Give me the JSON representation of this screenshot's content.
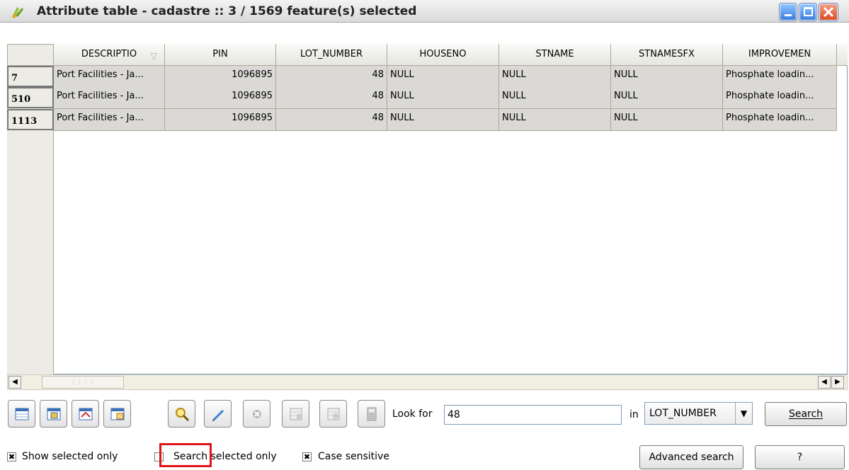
{
  "window": {
    "title": "Attribute table - cadastre :: 3 / 1569 feature(s) selected",
    "buttons": [
      "minimize",
      "maximize",
      "close"
    ]
  },
  "table": {
    "columns": [
      "DESCRIPTIO",
      "PIN",
      "LOT_NUMBER",
      "HOUSENO",
      "STNAME",
      "STNAMESFX",
      "IMPROVEMEN"
    ],
    "sort_indicator": "▽",
    "rows": [
      {
        "id": "7",
        "cells": [
          "Port Facilities - Ja...",
          "1096895",
          "48",
          "NULL",
          "NULL",
          "NULL",
          "Phosphate loadin..."
        ]
      },
      {
        "id": "510",
        "cells": [
          "Port Facilities - Ja...",
          "1096895",
          "48",
          "NULL",
          "NULL",
          "NULL",
          "Phosphate loadin..."
        ]
      },
      {
        "id": "1113",
        "cells": [
          "Port Facilities - Ja...",
          "1096895",
          "48",
          "NULL",
          "NULL",
          "NULL",
          "Phosphate loadin..."
        ]
      }
    ]
  },
  "search": {
    "look_for_label": "Look for",
    "look_for_value": "48",
    "in_label": "in",
    "field": "LOT_NUMBER",
    "search_button": "Search",
    "advanced_button": "Advanced search",
    "help_button": "?"
  },
  "options": {
    "show_selected_only": {
      "label": "Show selected only",
      "checked": true
    },
    "search_selected_only": {
      "label": "Search selected only",
      "checked": false
    },
    "case_sensitive": {
      "label": "Case sensitive",
      "checked": true
    }
  },
  "toolbar": [
    "remove-selection-icon",
    "selected-to-top-icon",
    "invert-selection-icon",
    "copy-selected-rows-icon",
    "zoom-to-selection-icon",
    "toggle-editing-icon",
    "delete-selected-icon",
    "new-column-icon",
    "delete-column-icon",
    "field-calculator-icon"
  ],
  "colors": {
    "selection_highlight": "#e0141a",
    "selected_row": "#dad9d6"
  }
}
